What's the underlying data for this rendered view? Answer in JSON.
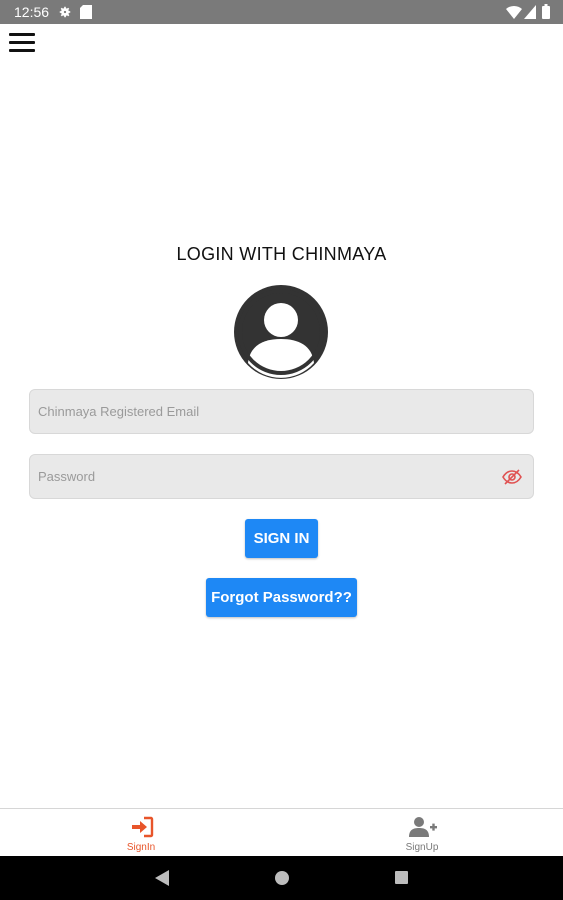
{
  "status_bar": {
    "time": "12:56"
  },
  "login": {
    "title": "LOGIN WITH CHINMAYA",
    "email_placeholder": "Chinmaya Registered Email",
    "email_value": "",
    "password_placeholder": "Password",
    "password_value": "",
    "signin_label": "SIGN IN",
    "forgot_label": "Forgot Password??"
  },
  "bottom_tabs": [
    {
      "label": "SignIn",
      "icon": "sign-in-icon",
      "active": true
    },
    {
      "label": "SignUp",
      "icon": "add-user-icon",
      "active": false
    }
  ],
  "colors": {
    "button_blue": "#1e88f5",
    "active_tab": "#e8552a",
    "inactive_tab": "#7a7a7a",
    "eye_icon": "#e05252",
    "avatar": "#333333"
  }
}
